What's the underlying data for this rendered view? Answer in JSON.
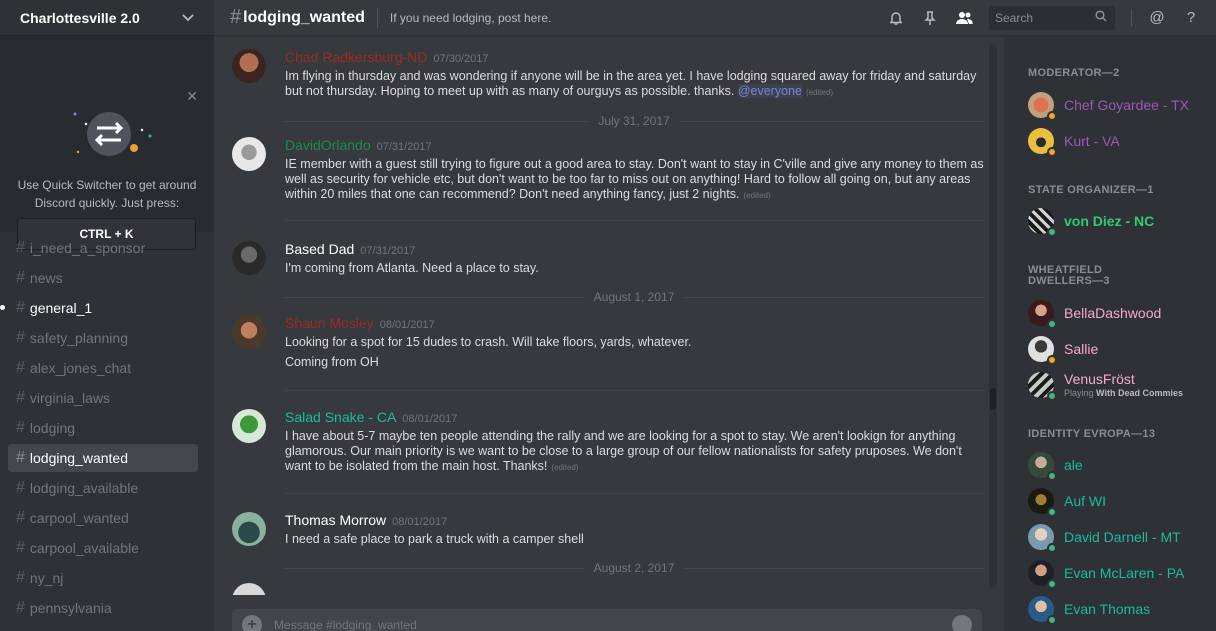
{
  "server": {
    "name": "Charlottesville 2.0"
  },
  "quick_switcher": {
    "text": "Use Quick Switcher to get around Discord quickly. Just press:",
    "shortcut": "CTRL + K"
  },
  "channels": [
    {
      "name": "i_need_a_sponsor",
      "state": "normal"
    },
    {
      "name": "news",
      "state": "normal"
    },
    {
      "name": "general_1",
      "state": "unread"
    },
    {
      "name": "safety_planning",
      "state": "normal"
    },
    {
      "name": "alex_jones_chat",
      "state": "normal"
    },
    {
      "name": "virginia_laws",
      "state": "normal"
    },
    {
      "name": "lodging",
      "state": "normal"
    },
    {
      "name": "lodging_wanted",
      "state": "selected"
    },
    {
      "name": "lodging_available",
      "state": "normal"
    },
    {
      "name": "carpool_wanted",
      "state": "normal"
    },
    {
      "name": "carpool_available",
      "state": "normal"
    },
    {
      "name": "ny_nj",
      "state": "normal"
    },
    {
      "name": "pennsylvania",
      "state": "normal"
    }
  ],
  "header": {
    "hash": "#",
    "channel": "lodging_wanted",
    "topic": "If you need lodging, post here.",
    "search_placeholder": "Search"
  },
  "messages": [
    {
      "author": "Chad Radkersburg-ND",
      "color": "#992d22",
      "timestamp": "07/30/2017",
      "avatar_color": "#7a4a3a",
      "lines": [
        "Im flying in thursday and was wondering if anyone will be in the area yet. I have lodging squared away for friday and saturday but not thursday. Hoping to meet up with as many of ourguys as possible. thanks."
      ],
      "mention": "@everyone",
      "edited": "(edited)"
    },
    {
      "divider": "July 31, 2017"
    },
    {
      "author": "DavidOrlando",
      "color": "#1f8b4c",
      "timestamp": "07/31/2017",
      "avatar_color": "#d8d8d8",
      "lines": [
        "IE member with a guest still trying to figure out a good area to stay. Don't want to stay in C'ville and give any money to them as well as security for vehicle etc, but don't want to be too far to miss out on anything! Hard to follow all going on, but any areas within 20 miles that one can recommend? Don't need anything fancy, just 2 nights."
      ],
      "edited": "(edited)"
    },
    {
      "author": "Based Dad",
      "color": "#ffffff",
      "timestamp": "07/31/2017",
      "avatar_color": "#4a4a4a",
      "lines": [
        "I'm coming from Atlanta. Need a place to stay."
      ]
    },
    {
      "divider": "August 1, 2017"
    },
    {
      "author": "Shaun Mosley",
      "color": "#992d22",
      "timestamp": "08/01/2017",
      "avatar_color": "#8a5a3a",
      "lines": [
        "Looking for a spot for 15 dudes to crash. Will take floors, yards, whatever.",
        "Coming from OH"
      ]
    },
    {
      "author": "Salad Snake - CA",
      "color": "#1abc9c",
      "timestamp": "08/01/2017",
      "avatar_color": "#5a8a5a",
      "lines": [
        "I have about 5-7 maybe ten people attending the rally and we are looking for a spot to stay.  We aren't lookign for anything glamorous.  Our main priority is we want to be close to a large group of our fellow nationalists for safety pruposes.  We don't want to be isolated from the main host.  Thanks!"
      ],
      "edited": "(edited)"
    },
    {
      "author": "Thomas Morrow",
      "color": "#ffffff",
      "timestamp": "08/01/2017",
      "avatar_color": "#3a5a5a",
      "lines": [
        "I need a safe place to park a truck with a camper shell"
      ]
    },
    {
      "divider": "August 2, 2017"
    }
  ],
  "composer": {
    "placeholder": "Message #lodging_wanted"
  },
  "member_groups": [
    {
      "label": "MODERATOR—2",
      "members": [
        {
          "name": "Chef Goyardee - TX",
          "color": "#9b59b6",
          "status": "idle",
          "avatar_color": "#d35a3a"
        },
        {
          "name": "Kurt - VA",
          "color": "#9b59b6",
          "status": "idle",
          "avatar_color": "#e8c040"
        }
      ]
    },
    {
      "label": "STATE ORGANIZER—1",
      "members": [
        {
          "name": "von Diez - NC",
          "color": "#2ecc71",
          "status": "online",
          "avatar_color": "#3a4a3a"
        }
      ]
    },
    {
      "label": "WHEATFIELD DWELLERS—3",
      "members": [
        {
          "name": "BellaDashwood",
          "color": "#f5a9d0",
          "status": "online",
          "avatar_color": "#5a2a2a"
        },
        {
          "name": "Sallie",
          "color": "#f5a9d0",
          "status": "idle",
          "avatar_color": "#d8d8d8"
        },
        {
          "name": "VenusFröst",
          "color": "#f5a9d0",
          "status": "online",
          "avatar_color": "#8a8a8a",
          "activity_prefix": "Playing",
          "activity": "With Dead Commies"
        }
      ]
    },
    {
      "label": "IDENTITY EVROPA—13",
      "members": [
        {
          "name": "ale",
          "color": "#1abc9c",
          "status": "online",
          "avatar_color": "#6a7a6a"
        },
        {
          "name": "Auf WI",
          "color": "#1abc9c",
          "status": "online",
          "avatar_color": "#3a3a20"
        },
        {
          "name": "David Darnell - MT",
          "color": "#1abc9c",
          "status": "online",
          "avatar_color": "#9ab0c0"
        },
        {
          "name": "Evan McLaren - PA",
          "color": "#1abc9c",
          "status": "online",
          "avatar_color": "#3a3a4a"
        },
        {
          "name": "Evan Thomas",
          "color": "#1abc9c",
          "status": "online",
          "avatar_color": "#3a6a9a"
        }
      ]
    }
  ]
}
